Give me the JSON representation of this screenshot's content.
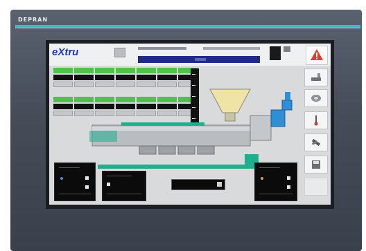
{
  "device": {
    "brand": "DEPRAN"
  },
  "screen": {
    "logo": "eXtru",
    "alarm_icon": "warning-triangle-icon",
    "side_buttons": [
      {
        "name": "side-button-screw",
        "icon": "extruder-icon"
      },
      {
        "name": "side-button-roll",
        "icon": "roll-icon"
      },
      {
        "name": "side-button-temperature",
        "icon": "thermometer-icon"
      },
      {
        "name": "side-button-tools",
        "icon": "tools-icon"
      },
      {
        "name": "side-button-save",
        "icon": "save-icon"
      }
    ]
  },
  "colors": {
    "accent_stripe": "#3ab8c8",
    "heater_on": "#4ec24a",
    "machine_base": "#1fae8e",
    "progress_bar": "#1f2a82",
    "alarm": "#e23b2a"
  }
}
